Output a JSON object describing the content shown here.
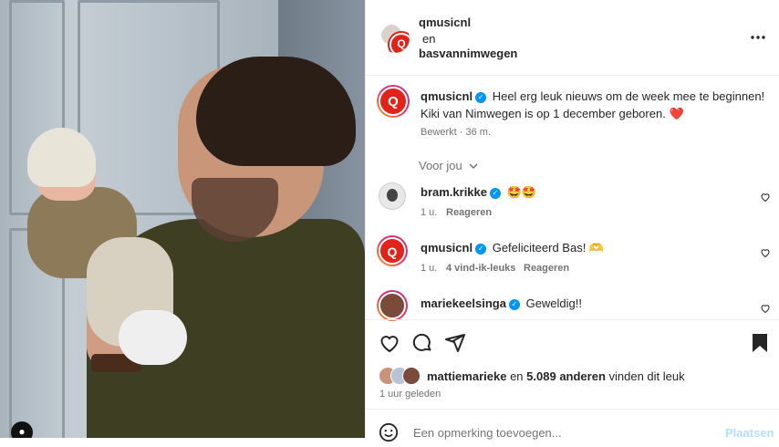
{
  "header": {
    "user1": "qmusicnl",
    "connector": "en",
    "user2": "basvannimwegen",
    "more_icon": "more-horizontal-icon"
  },
  "caption": {
    "username": "qmusicnl",
    "text_line1": "Heel erg leuk nieuws om de week mee te beginnen!",
    "text_line2": "Kiki van Nimwegen is op 1 december geboren.",
    "emoji": "❤️",
    "meta": "Bewerkt · 36 m."
  },
  "for_you": "Voor jou",
  "comments": [
    {
      "username": "bram.krikke",
      "text": "🤩🤩",
      "time": "1 u.",
      "likes": "",
      "reply": "Reageren"
    },
    {
      "username": "qmusicnl",
      "text": "Gefeliciteerd Bas! 🫶",
      "time": "1 u.",
      "likes": "4 vind-ik-leuks",
      "reply": "Reageren"
    },
    {
      "username": "mariekeelsinga",
      "text": "Geweldig!!",
      "time": "",
      "likes": "",
      "reply": ""
    }
  ],
  "likes": {
    "first_user": "mattiemarieke",
    "connector": "en",
    "count_text": "5.089 anderen",
    "suffix": "vinden dit leuk"
  },
  "time_ago": "1 uur geleden",
  "comment_input": {
    "placeholder": "Een opmerking toevoegen...",
    "post_label": "Plaatsen"
  },
  "colors": {
    "accent": "#0095f6",
    "q_red": "#e2231a",
    "heart": "#ed4956"
  }
}
